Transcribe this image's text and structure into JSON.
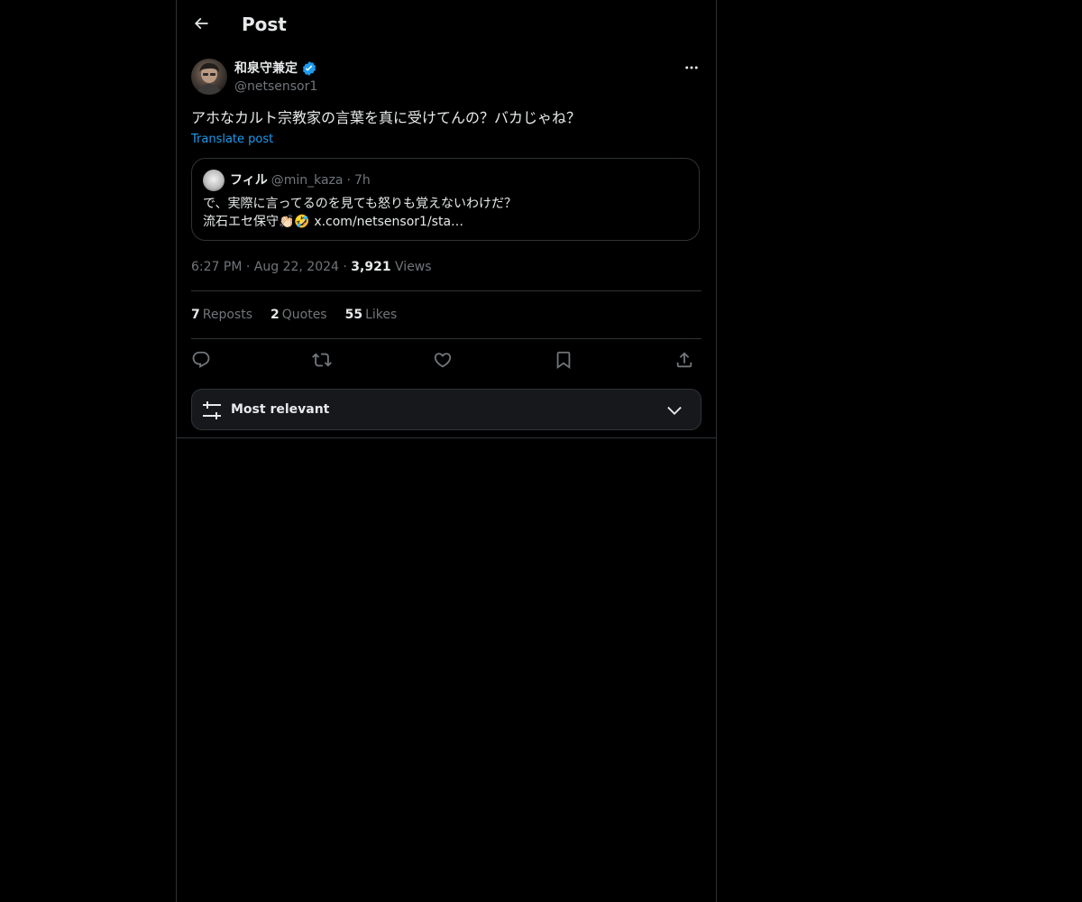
{
  "header": {
    "title": "Post",
    "back_icon": "arrow-left-icon"
  },
  "post": {
    "author": {
      "display_name": "和泉守兼定",
      "handle": "@netsensor1",
      "verified": true
    },
    "text": "アホなカルト宗教家の言葉を真に受けてんの？バカじゃね？",
    "translate_label": "Translate post",
    "quote": {
      "name": "フィル",
      "handle": "@min_kaza",
      "separator": "·",
      "time": "7h",
      "line1": "で、実際に言ってるのを見ても怒りも覚えないわけだ？",
      "line2": "流石エセ保守👏🏻🤣 x.com/netsensor1/sta…"
    },
    "time": "6:27 PM",
    "dot": "·",
    "date": "Aug 22, 2024",
    "views_count": "3,921",
    "views_label": "Views"
  },
  "stats": {
    "reposts_count": "7",
    "reposts_label": "Reposts",
    "quotes_count": "2",
    "quotes_label": "Quotes",
    "likes_count": "55",
    "likes_label": "Likes"
  },
  "actions": {
    "reply_icon": "reply-icon",
    "repost_icon": "repost-icon",
    "like_icon": "heart-icon",
    "bookmark_icon": "bookmark-icon",
    "share_icon": "share-icon"
  },
  "sort": {
    "label": "Most relevant"
  },
  "colors": {
    "background": "#000000",
    "text": "#e7e9ea",
    "muted": "#71767b",
    "accent": "#1d9bf0",
    "border": "#2f3336"
  }
}
